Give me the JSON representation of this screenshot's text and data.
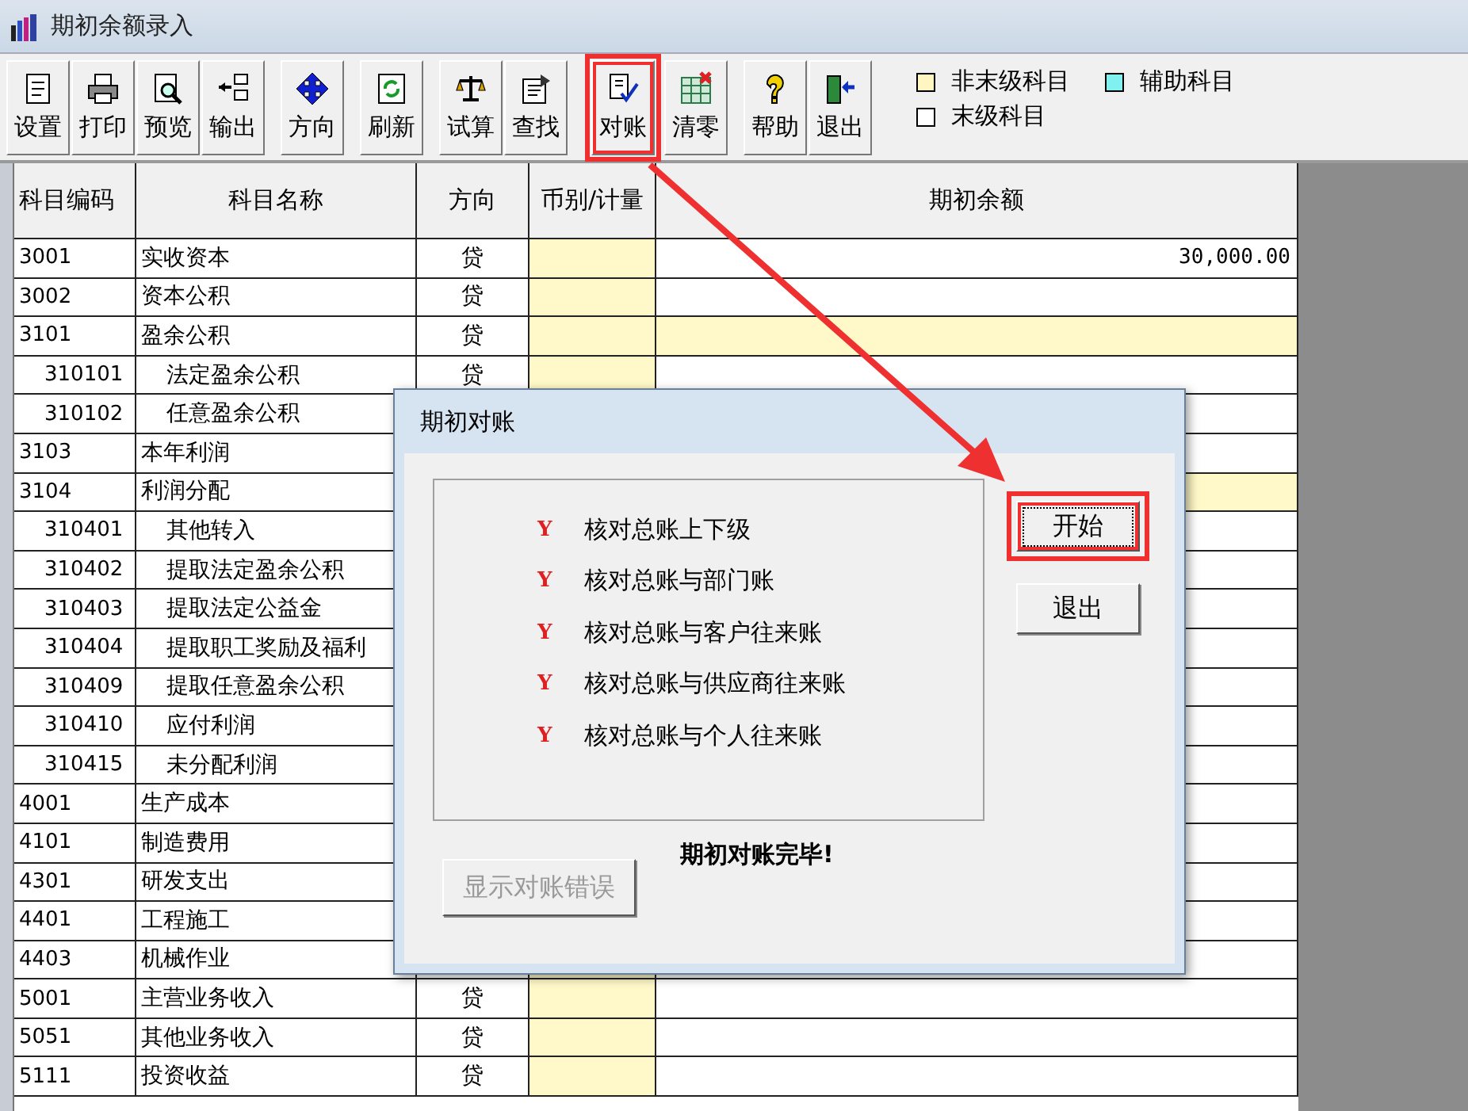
{
  "window": {
    "title": "期初余额录入"
  },
  "toolbar": [
    {
      "buttons": [
        {
          "label": "设置",
          "highlighted": false
        },
        {
          "label": "打印",
          "highlighted": false
        },
        {
          "label": "预览",
          "highlighted": false
        },
        {
          "label": "输出",
          "highlighted": false
        }
      ]
    },
    {
      "buttons": [
        {
          "label": "方向",
          "highlighted": false
        }
      ]
    },
    {
      "buttons": [
        {
          "label": "刷新",
          "highlighted": false
        }
      ]
    },
    {
      "buttons": [
        {
          "label": "试算",
          "highlighted": false
        },
        {
          "label": "查找",
          "highlighted": false
        }
      ]
    },
    {
      "buttons": [
        {
          "label": "对账",
          "highlighted": true
        },
        {
          "label": "清零",
          "highlighted": false
        }
      ]
    },
    {
      "buttons": [
        {
          "label": "帮助",
          "highlighted": false
        },
        {
          "label": "退出",
          "highlighted": false
        }
      ]
    }
  ],
  "legend": [
    {
      "label": "非末级科目",
      "color": "#fff6c2"
    },
    {
      "label": "辅助科目",
      "color": "#80f0f0"
    },
    {
      "label": "末级科目",
      "color": "#ffffff"
    }
  ],
  "table": {
    "columns": [
      "科目编码",
      "科目名称",
      "方向",
      "币别/计量",
      "期初余额"
    ],
    "rows": [
      {
        "code": "3001",
        "name": "实收资本",
        "direction": "贷",
        "balance": "30,000.00"
      },
      {
        "code": "3002",
        "name": "资本公积",
        "direction": "贷"
      },
      {
        "code": "3101",
        "name": "盈余公积",
        "direction": "贷",
        "children": [
          {
            "code": "310101",
            "name": "法定盈余公积",
            "direction": "贷"
          },
          {
            "code": "310102",
            "name": "任意盈余公积"
          }
        ]
      },
      {
        "code": "3103",
        "name": "本年利润"
      },
      {
        "code": "3104",
        "name": "利润分配",
        "children": [
          {
            "code": "310401",
            "name": "其他转入"
          },
          {
            "code": "310402",
            "name": "提取法定盈余公积"
          },
          {
            "code": "310403",
            "name": "提取法定公益金"
          },
          {
            "code": "310404",
            "name": "提取职工奖励及福利"
          },
          {
            "code": "310409",
            "name": "提取任意盈余公积"
          },
          {
            "code": "310410",
            "name": "应付利润"
          },
          {
            "code": "310415",
            "name": "未分配利润"
          }
        ]
      },
      {
        "code": "4001",
        "name": "生产成本"
      },
      {
        "code": "4101",
        "name": "制造费用"
      },
      {
        "code": "4301",
        "name": "研发支出"
      },
      {
        "code": "4401",
        "name": "工程施工"
      },
      {
        "code": "4403",
        "name": "机械作业"
      },
      {
        "code": "5001",
        "name": "主营业务收入",
        "direction": "贷"
      },
      {
        "code": "5051",
        "name": "其他业务收入",
        "direction": "贷"
      },
      {
        "code": "5111",
        "name": "投资收益",
        "direction": "贷"
      }
    ]
  },
  "dialog": {
    "title": "期初对账",
    "checks": [
      {
        "mark": "Y",
        "label": "核对总账上下级"
      },
      {
        "mark": "Y",
        "label": "核对总账与部门账"
      },
      {
        "mark": "Y",
        "label": "核对总账与客户往来账"
      },
      {
        "mark": "Y",
        "label": "核对总账与供应商往来账"
      },
      {
        "mark": "Y",
        "label": "核对总账与个人往来账"
      }
    ],
    "buttons": [
      {
        "label": "开始",
        "focused": true,
        "highlighted": true
      },
      {
        "label": "退出",
        "focused": false,
        "highlighted": false
      }
    ],
    "status": "期初对账完毕!",
    "error_button": {
      "label": "显示对账错误",
      "disabled": true
    }
  }
}
